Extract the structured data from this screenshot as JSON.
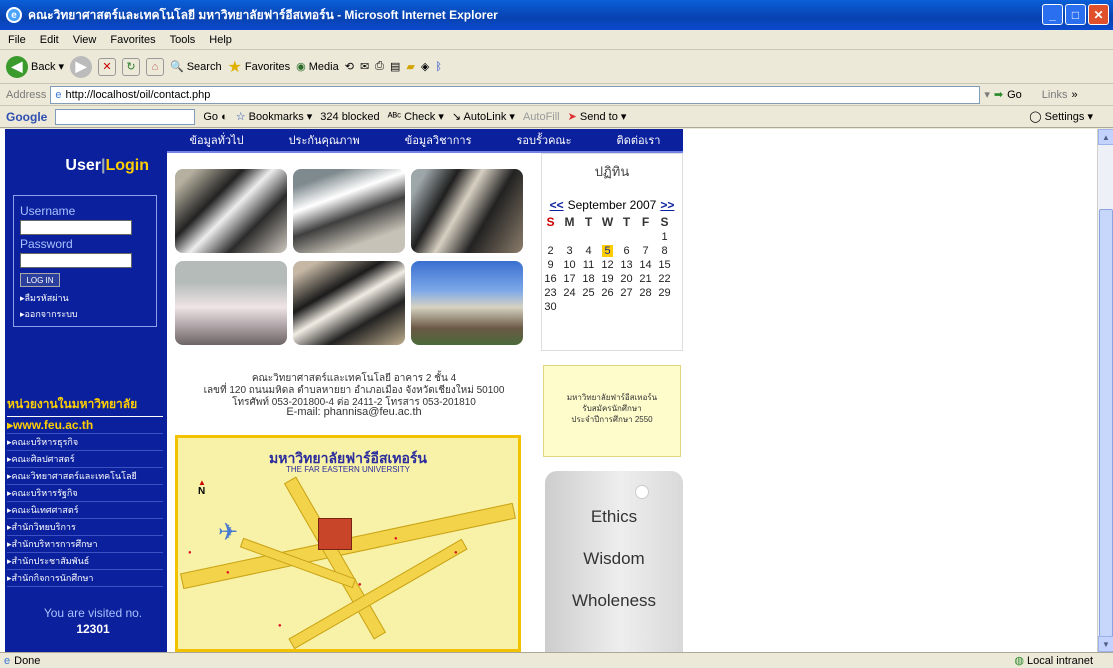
{
  "window": {
    "title": "คณะวิทยาศาสตร์และเทคโนโลยี มหาวิทยาลัยฟาร์อีสเทอร์น - Microsoft Internet Explorer"
  },
  "menu": [
    "File",
    "Edit",
    "View",
    "Favorites",
    "Tools",
    "Help"
  ],
  "toolbar": {
    "back": "Back",
    "search": "Search",
    "favorites": "Favorites",
    "media": "Media"
  },
  "address": {
    "label": "Address",
    "url": "http://localhost/oil/contact.php",
    "go": "Go",
    "links": "Links"
  },
  "google": {
    "label": "Google",
    "go": "Go",
    "bookmarks": "Bookmarks",
    "blocked": "324 blocked",
    "check": "Check",
    "autolink": "AutoLink",
    "autofill": "AutoFill",
    "sendto": "Send to",
    "settings": "Settings"
  },
  "nav": [
    "ข้อมูลทั่วไป",
    "ประกันคุณภาพ",
    "ข้อมูลวิชาการ",
    "รอบรั้วคณะ",
    "ติดต่อเรา"
  ],
  "login": {
    "user": "User",
    "sep": "|",
    "login": "Login",
    "username": "Username",
    "password": "Password",
    "button": "LOG IN",
    "forgot": "▸ลืมรหัสผ่าน",
    "logout": "▸ออกจากระบบ"
  },
  "units": {
    "heading": "หน่วยงานในมหาวิทยาลัย",
    "items": [
      "▸www.feu.ac.th",
      "▸คณะบริหารธุรกิจ",
      "▸คณะศิลปศาสตร์",
      "▸คณะวิทยาศาสตร์และเทคโนโลยี",
      "▸คณะบริหารรัฐกิจ",
      "▸คณะนิเทศศาสตร์",
      "▸สำนักวิทยบริการ",
      "▸สำนักบริหารการศึกษา",
      "▸สำนักประชาสัมพันธ์",
      "▸สำนักกิจการนักศึกษา"
    ]
  },
  "visits": {
    "label": "You are visited no.",
    "count": "12301"
  },
  "address_text": {
    "line1": "คณะวิทยาศาสตร์และเทคโนโลยี อาคาร 2 ชั้น 4",
    "line2": "เลขที่ 120 ถนนมหิดล ตำบลหายยา อำเภอเมือง จังหวัดเชียงใหม่ 50100",
    "line3": "โทรศัพท์ 053-201800-4 ต่อ 2411-2 โทรสาร 053-201810",
    "line4": "E-mail: phannisa@feu.ac.th"
  },
  "map": {
    "title": "มหาวิทยาลัยฟาร์อีสเทอร์น",
    "subtitle": "THE FAR EASTERN UNIVERSITY",
    "north": "N"
  },
  "calendar": {
    "title": "ปฏิทิน",
    "prev": "<<",
    "month": "September 2007",
    "next": ">>",
    "dow": [
      "S",
      "M",
      "T",
      "W",
      "T",
      "F",
      "S"
    ],
    "days": [
      "",
      "",
      "",
      "",
      "",
      "",
      "1",
      "2",
      "3",
      "4",
      "5",
      "6",
      "7",
      "8",
      "9",
      "10",
      "11",
      "12",
      "13",
      "14",
      "15",
      "16",
      "17",
      "18",
      "19",
      "20",
      "21",
      "22",
      "23",
      "24",
      "25",
      "26",
      "27",
      "28",
      "29",
      "30"
    ],
    "today": "5"
  },
  "promo": {
    "line1": "มหาวิทยาลัยฟาร์อีสเทอร์น",
    "line2": "รับสมัครนักศึกษา",
    "line3": "ประจำปีการศึกษา 2550"
  },
  "values": [
    "Ethics",
    "Wisdom",
    "Wholeness"
  ],
  "status": {
    "left": "Done",
    "zone": "Local intranet"
  }
}
